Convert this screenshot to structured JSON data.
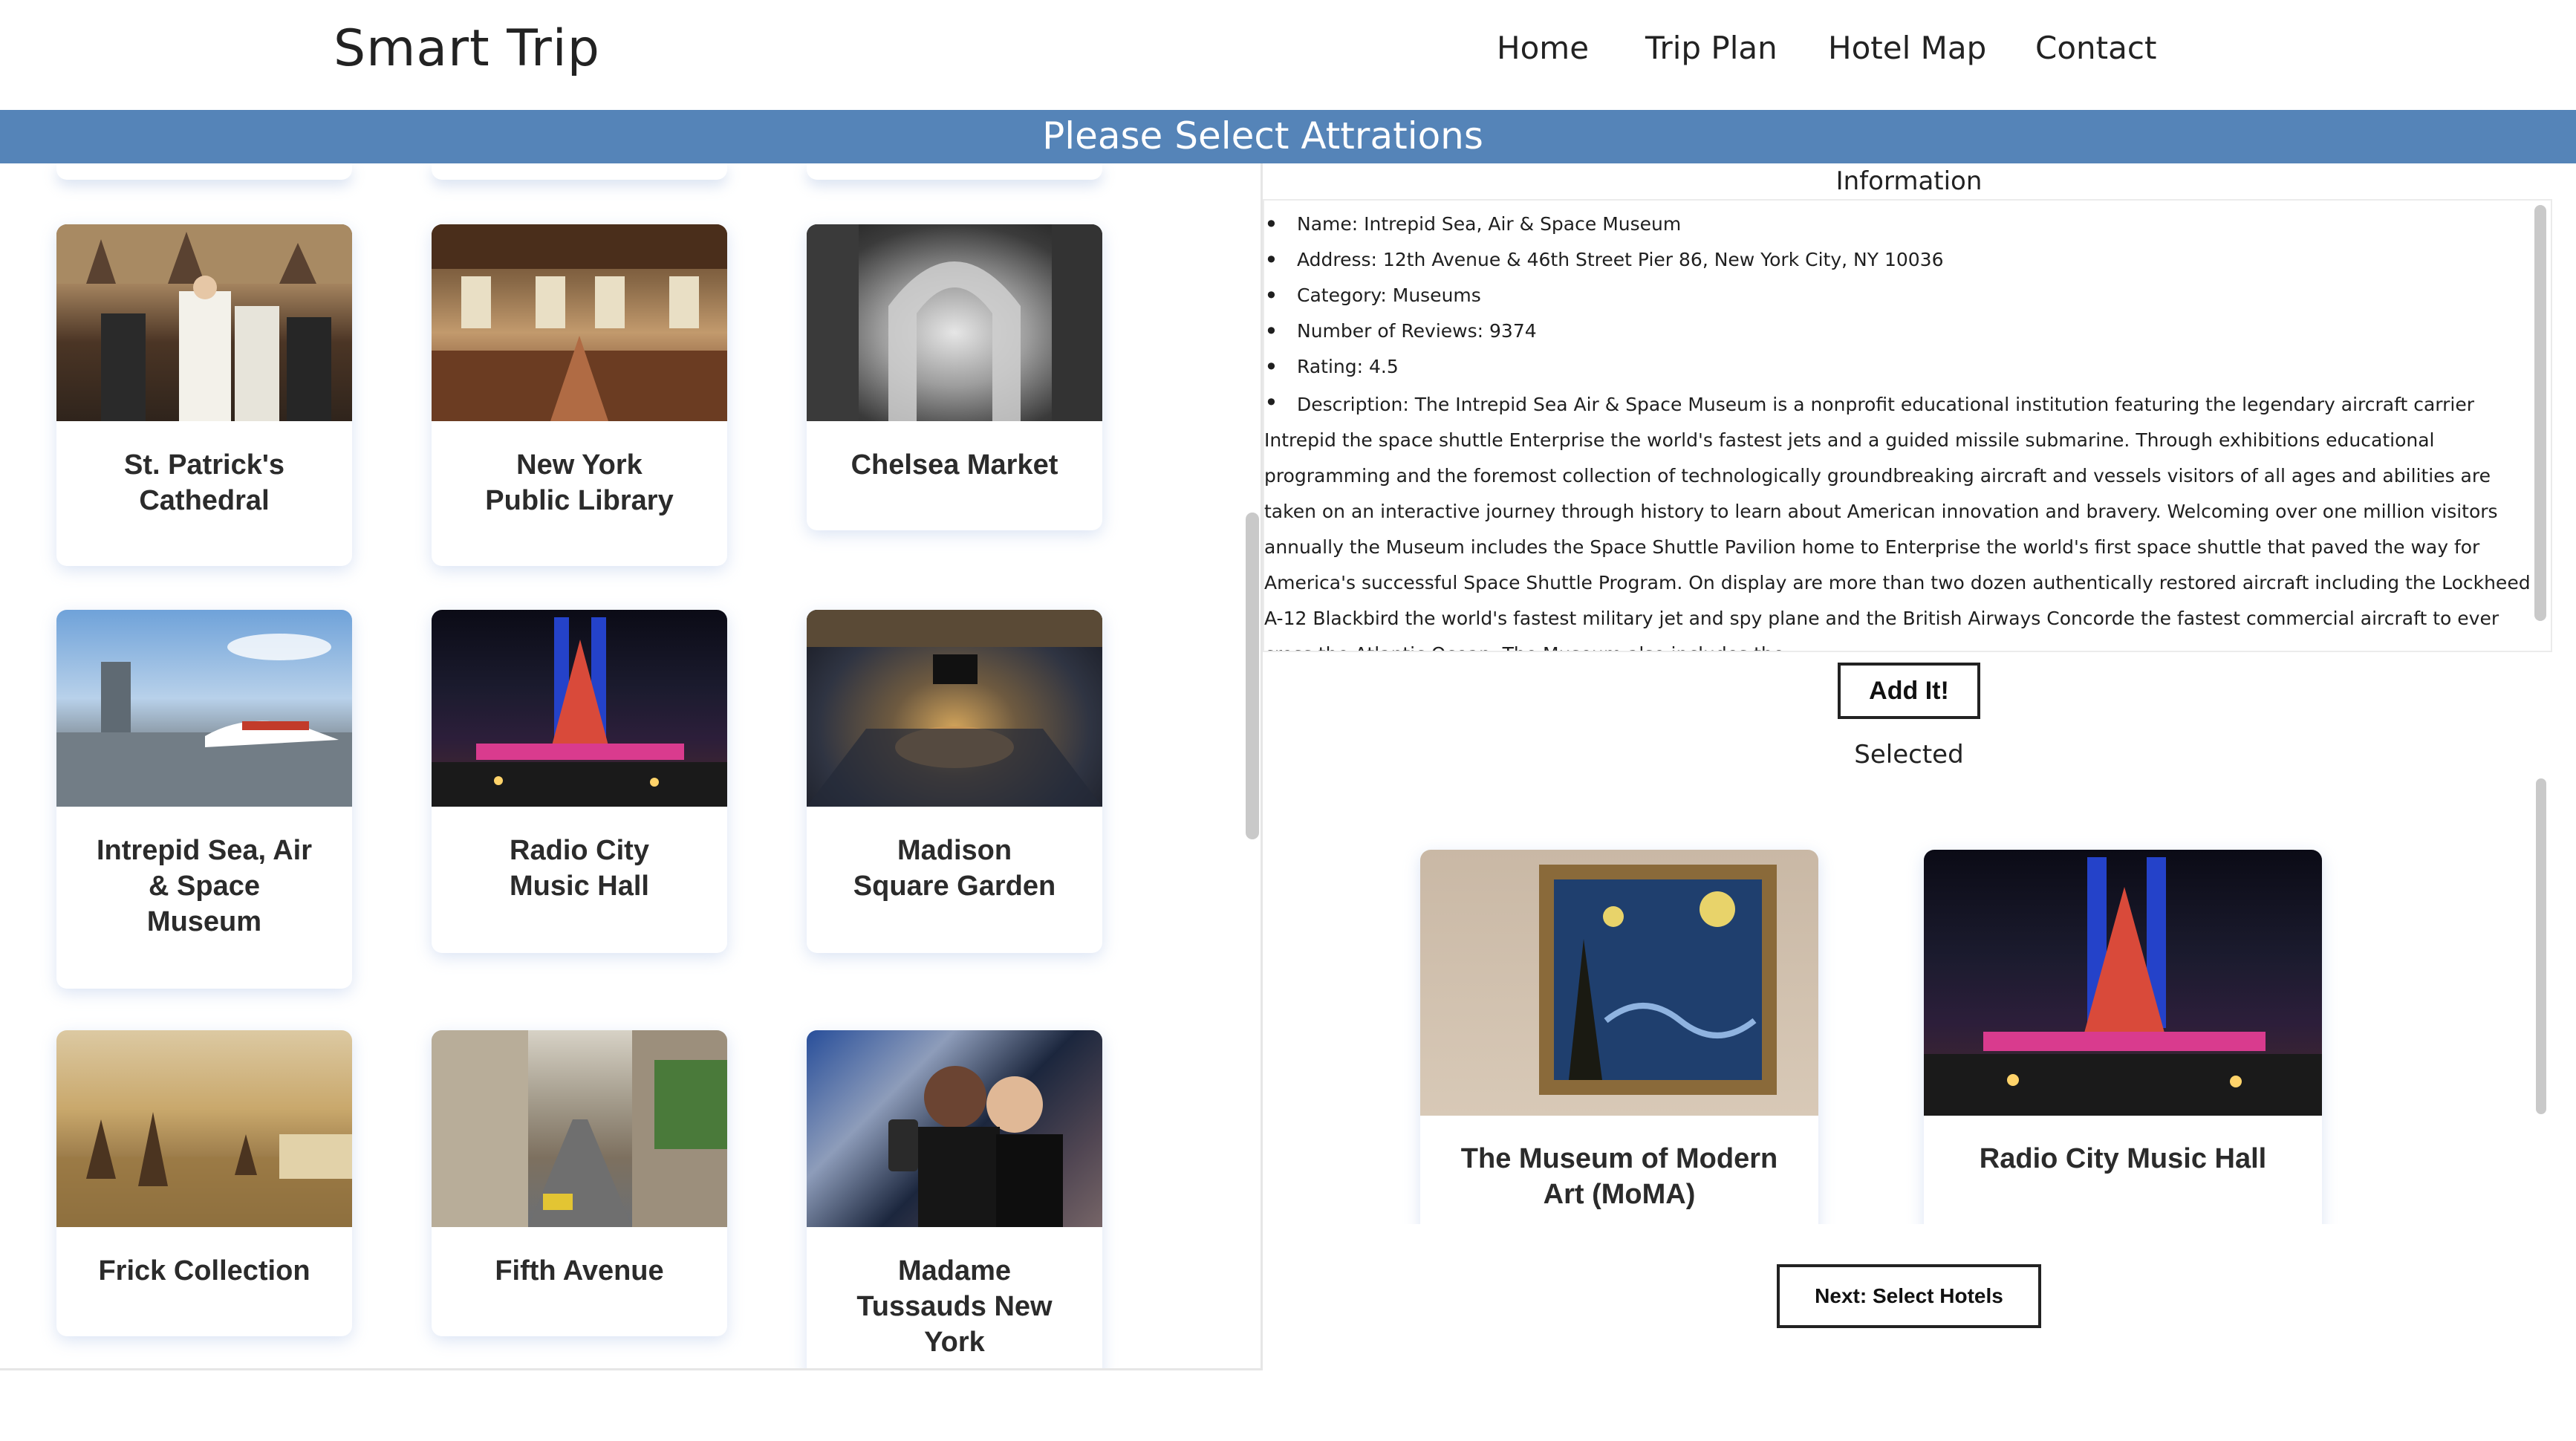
{
  "header": {
    "brand": "Smart Trip",
    "nav": [
      "Home",
      "Trip Plan",
      "Hotel Map",
      "Contact"
    ]
  },
  "banner": {
    "title": "Please Select Attrations"
  },
  "attractions": [
    {
      "name": "St. Patrick's Cathedral",
      "line1": "St. Patrick's",
      "line2": "Cathedral",
      "line3": ""
    },
    {
      "name": "New York Public Library",
      "line1": "New York",
      "line2": "Public Library",
      "line3": ""
    },
    {
      "name": "Chelsea Market",
      "line1": "Chelsea Market",
      "line2": "",
      "line3": ""
    },
    {
      "name": "Intrepid Sea, Air & Space Museum",
      "line1": "Intrepid Sea, Air",
      "line2": "& Space",
      "line3": "Museum"
    },
    {
      "name": "Radio City Music Hall",
      "line1": "Radio City",
      "line2": "Music Hall",
      "line3": ""
    },
    {
      "name": "Madison Square Garden",
      "line1": "Madison",
      "line2": "Square Garden",
      "line3": ""
    },
    {
      "name": "Frick Collection",
      "line1": "Frick Collection",
      "line2": "",
      "line3": ""
    },
    {
      "name": "Fifth Avenue",
      "line1": "Fifth Avenue",
      "line2": "",
      "line3": ""
    },
    {
      "name": "Madame Tussauds New York",
      "line1": "Madame",
      "line2": "Tussauds New",
      "line3": "York"
    }
  ],
  "info": {
    "title": "Information",
    "name": "Name: Intrepid Sea, Air & Space Museum",
    "address": "Address: 12th Avenue & 46th Street Pier 86, New York City, NY 10036",
    "category": "Category: Museums",
    "reviews": "Number of Reviews: 9374",
    "rating": "Rating: 4.5",
    "description": "Description: The Intrepid Sea Air & Space Museum is a nonprofit educational institution featuring the legendary aircraft carrier Intrepid the space shuttle Enterprise the world's fastest jets and a guided missile submarine. Through exhibitions educational programming and the foremost collection of technologically groundbreaking aircraft and vessels visitors of all ages and abilities are taken on an interactive journey through history to learn about American innovation and bravery. Welcoming over one million visitors annually the Museum includes the Space Shuttle Pavilion home to Enterprise the world's first space shuttle that paved the way for America's successful Space Shuttle Program. On display are more than two dozen authentically restored aircraft including the Lockheed A-12 Blackbird the world's fastest military jet and spy plane and the British Airways Concorde the fastest commercial aircraft to ever cross the Atlantic Ocean. The Museum also includes the"
  },
  "add_button": "Add It!",
  "selected": {
    "title": "Selected",
    "items": [
      {
        "line1": "The Museum of Modern",
        "line2": "Art (MoMA)"
      },
      {
        "line1": "Radio City Music Hall",
        "line2": ""
      }
    ]
  },
  "next_button": "Next: Select Hotels"
}
